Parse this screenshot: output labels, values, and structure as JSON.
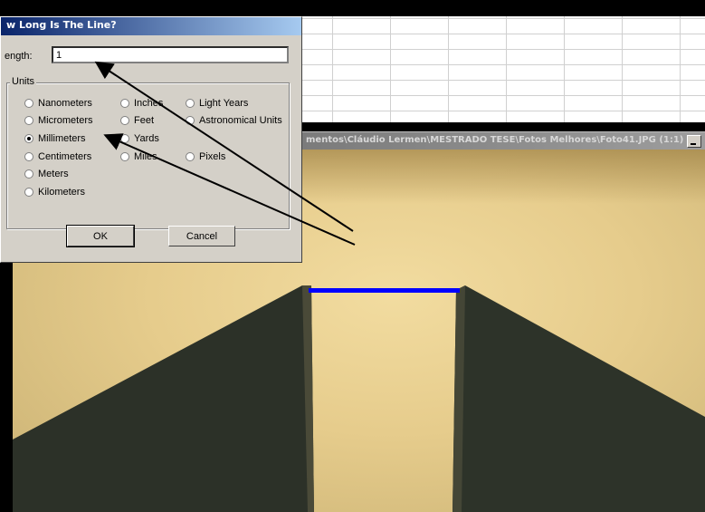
{
  "dialog": {
    "title": "w Long Is The Line?",
    "length_label": "ength:",
    "length_value": "1",
    "units_label": "Units",
    "units": [
      {
        "label": "Nanometers",
        "checked": false
      },
      {
        "label": "Inches",
        "checked": false
      },
      {
        "label": "Light Years",
        "checked": false
      },
      {
        "label": "Micrometers",
        "checked": false
      },
      {
        "label": "Feet",
        "checked": false
      },
      {
        "label": "Astronomical Units",
        "checked": false
      },
      {
        "label": "Millimeters",
        "checked": true
      },
      {
        "label": "Yards",
        "checked": false
      },
      {
        "label": "Centimeters",
        "checked": false
      },
      {
        "label": "Miles",
        "checked": false
      },
      {
        "label": "Pixels",
        "checked": false
      },
      {
        "label": "Meters",
        "checked": false
      },
      {
        "label": "Kilometers",
        "checked": false
      }
    ],
    "ok_label": "OK",
    "cancel_label": "Cancel"
  },
  "viewer": {
    "title": "mentos\\Cláudio Lermen\\MESTRADO TESE\\Fotos Melhores\\Foto41.JPG (1:1)"
  },
  "colors": {
    "measure_line": "#0000ff",
    "annotation_arrow": "#000000"
  }
}
